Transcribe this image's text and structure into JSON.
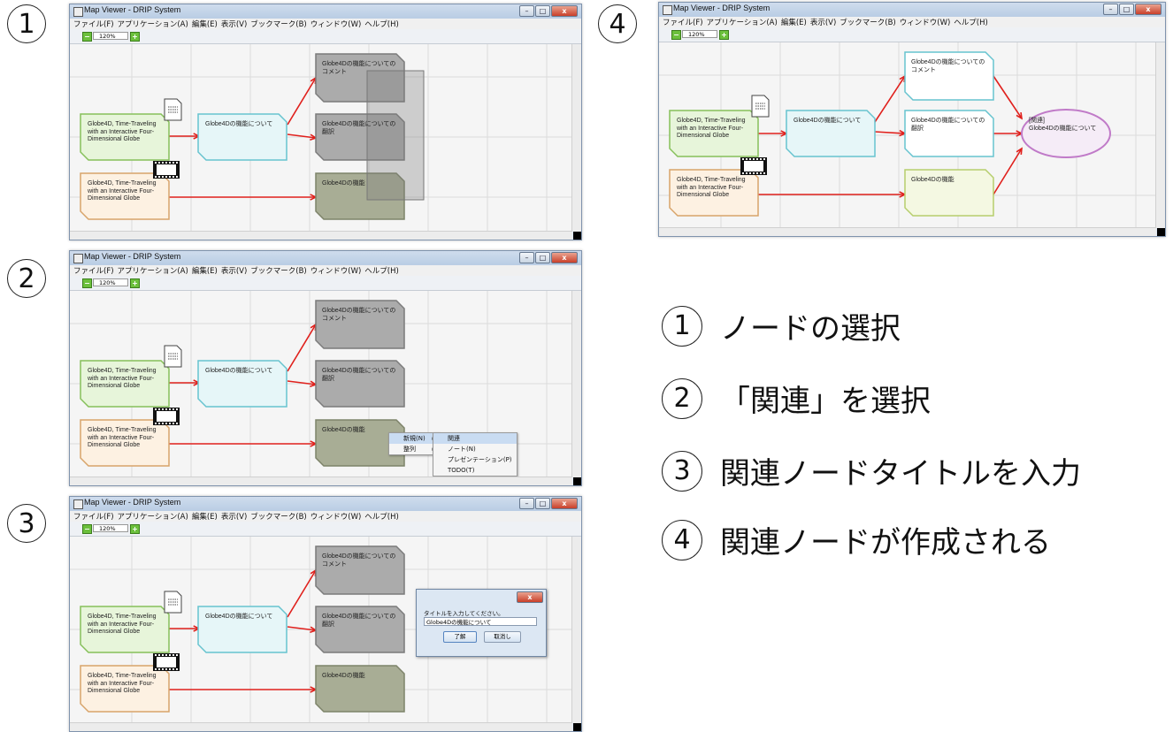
{
  "window": {
    "title": "Map Viewer - DRIP System",
    "menu": [
      "ファイル(F)",
      "アプリケーション(A)",
      "編集(E)",
      "表示(V)",
      "ブックマーク(B)",
      "ウィンドウ(W)",
      "ヘルプ(H)"
    ],
    "zoom": "120%",
    "close_glyph": "x",
    "min_glyph": "–",
    "max_glyph": "□"
  },
  "nodes": {
    "source1": "Globe4D, Time-Traveling\nwith an Interactive Four-\nDimensional Globe",
    "source2": "Globe4D, Time-Traveling\nwith an Interactive Four-\nDimensional Globe",
    "about": "Globe4Dの機能について",
    "comment": "Globe4Dの機能についての\nコメント",
    "translation": "Globe4Dの機能についての\n翻訳",
    "feature": "Globe4Dの機能",
    "relation": "[関連]\nGlobe4Dの機能について"
  },
  "context_menu": {
    "new": "新規(N)",
    "align": "整列",
    "submenu": [
      "関連",
      "ノート(N)",
      "プレゼンテーション(P)",
      "TODO(T)"
    ]
  },
  "dialog": {
    "prompt": "タイトルを入力してください。",
    "input_value": "Globe4Dの機能について",
    "ok": "了解",
    "cancel": "取消し"
  },
  "steps": [
    {
      "num": "1",
      "text": "ノードの選択"
    },
    {
      "num": "2",
      "text": "「関連」を選択"
    },
    {
      "num": "3",
      "text": "関連ノードタイトルを入力"
    },
    {
      "num": "4",
      "text": "関連ノードが作成される"
    }
  ],
  "panel_numbers": [
    "1",
    "2",
    "3",
    "4"
  ],
  "colors": {
    "green_fill": "#e7f5da",
    "green_border": "#86c05a",
    "cyan_fill": "#e6f6f8",
    "cyan_border": "#67c3cf",
    "orange_fill": "#fdf1e2",
    "orange_border": "#d8a46a",
    "gray_fill": "#ababab",
    "gray_border": "#7b7b7b",
    "olive_fill": "#a8ad95",
    "olive_border": "#7d8369",
    "white_fill": "#ffffff",
    "pale_green_fill": "#f4f8e2",
    "pale_green_border": "#b6ce6c",
    "purple_border": "#c07ac8",
    "purple_fill": "#f5ecf7",
    "arrow": "#e0201c"
  }
}
